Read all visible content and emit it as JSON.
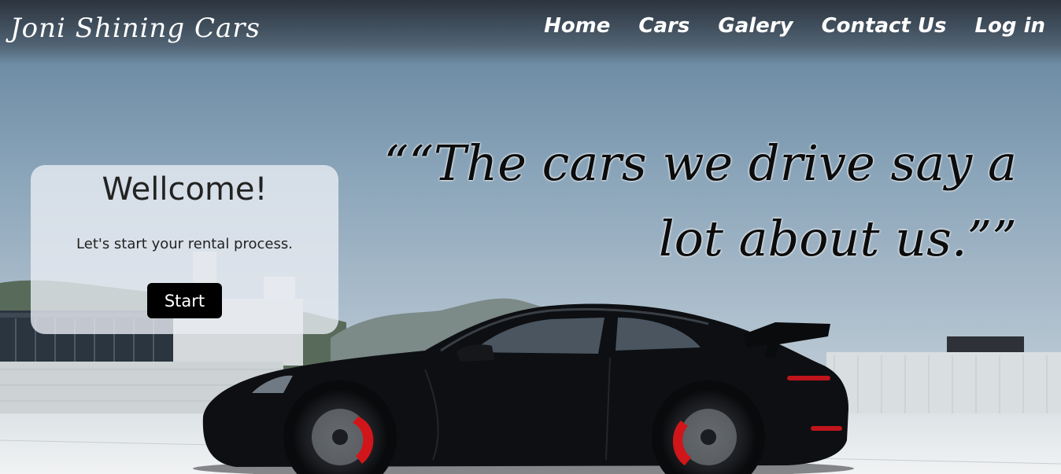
{
  "brand": {
    "name": "Joni Shining Cars"
  },
  "nav": {
    "items": [
      {
        "label": "Home"
      },
      {
        "label": "Cars"
      },
      {
        "label": "Galery"
      },
      {
        "label": "Contact Us"
      },
      {
        "label": "Log in"
      }
    ]
  },
  "hero": {
    "quote_line1": "““The cars we drive say a",
    "quote_line2": "lot about us.””"
  },
  "welcome": {
    "title": "Wellcome!",
    "text": "Let's start your rental process.",
    "button_label": "Start"
  },
  "colors": {
    "button_bg": "#000000",
    "nav_text": "#ffffff",
    "card_bg": "#e8ecf2",
    "car_body": "#0b0d10",
    "brake_caliper": "#d0161a"
  }
}
